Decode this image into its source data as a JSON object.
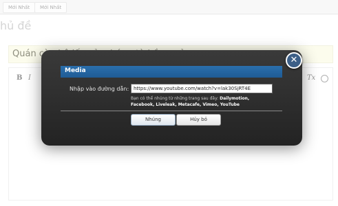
{
  "page": {
    "tabs": [
      "Mới Nhất",
      "Mới Nhất"
    ],
    "title": "hủ đề",
    "thread_title_value": "Quán cà phê lấy cảm hứng từ hầm mỏ"
  },
  "toolbar": {
    "bold": "B",
    "italic": "I",
    "remove_format": "Tx"
  },
  "dialog": {
    "title": "Media",
    "close": "✕",
    "url_label": "Nhập vào đường dẫn:",
    "url_value": "https://www.youtube.com/watch?v=lak30SjRT4E",
    "hint_prefix": "Bạn có thể nhúng từ những trang sau đây:",
    "hint_sites_line1": "Dailymotion,",
    "hint_sites_line2": "Facebook, Liveleak, Metacafe, Vimeo, YouTube",
    "embed_button": "Nhúng",
    "cancel_button": "Hủy bỏ"
  },
  "colors": {
    "dialog_header": "#2468a6",
    "dialog_body": "#2b2b2b",
    "close_button": "#3d5f87",
    "title_box": "#fbfbe8"
  }
}
